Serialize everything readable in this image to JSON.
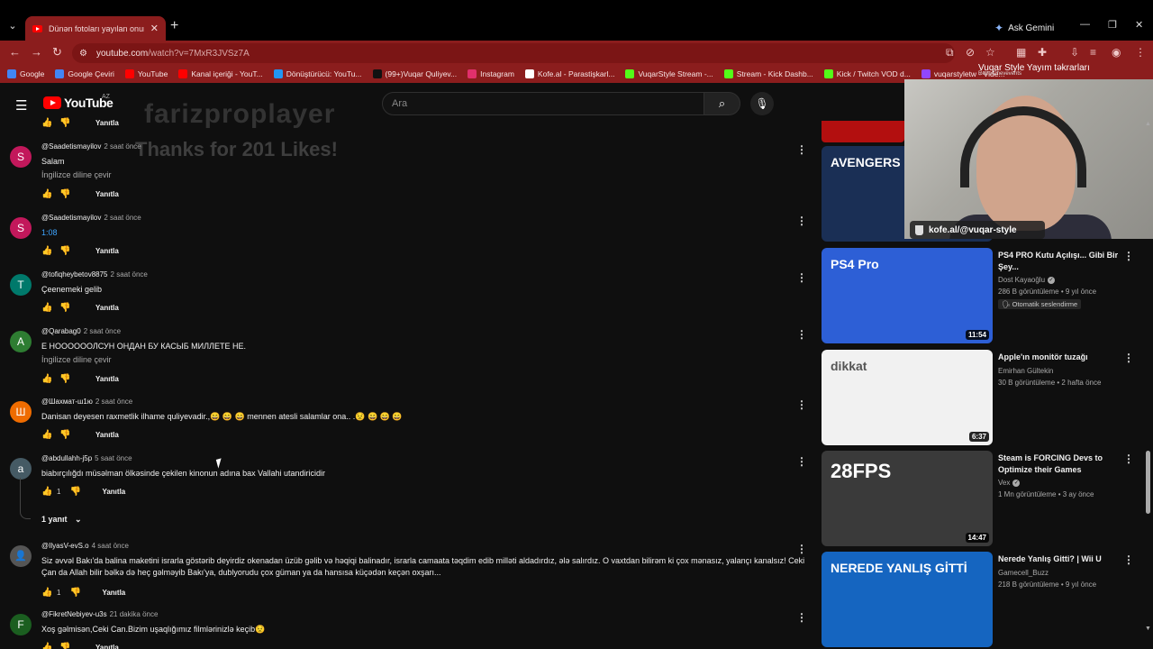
{
  "browser": {
    "tab_title": "Dünən fotoları yayılan onun du",
    "new_tab": "+",
    "ask_gemini": "Ask Gemini",
    "url_host": "youtube.com",
    "url_path": "/watch?v=7MxR3JVSz7A",
    "bookmarks": [
      {
        "label": "Google",
        "color": "#4285f4"
      },
      {
        "label": "Google Çeviri",
        "color": "#4285f4"
      },
      {
        "label": "YouTube",
        "color": "#ff0000"
      },
      {
        "label": "Kanal içeriği - YouT...",
        "color": "#ff0000"
      },
      {
        "label": "Dönüştürücü: YouTu...",
        "color": "#2196f3"
      },
      {
        "label": "(99+)Vuqar Quliyev...",
        "color": "#111111"
      },
      {
        "label": "Instagram",
        "color": "#e1306c"
      },
      {
        "label": "Kofe.al - Parastişkarl...",
        "color": "#ffffff"
      },
      {
        "label": "VuqarStyle Stream -...",
        "color": "#53fc18"
      },
      {
        "label": "Stream - Kick Dashb...",
        "color": "#53fc18"
      },
      {
        "label": "Kick / Twitch VOD d...",
        "color": "#53fc18"
      },
      {
        "label": "vuqarstyletw - Vide...",
        "color": "#9146ff"
      }
    ]
  },
  "youtube": {
    "logo_text": "YouTube",
    "region": "AZ",
    "search_placeholder": "Ara"
  },
  "overlays": {
    "name": "farizproplayer",
    "thanks": "Thanks for 201 Likes!",
    "stream_title": "Vuqar Style Yayım təkrarları",
    "stream_sub": "Retro/Chevevents",
    "kofe": "kofe.al/@vuqar-style"
  },
  "reply_label": "Yanıtla",
  "translate_label": "İngilizce diline çevir",
  "comments": [
    {
      "initial": "S",
      "color": "#c2185b",
      "author": "@Saadetismayilov",
      "time": "2 saat önce",
      "text": "Salam",
      "translate": true,
      "likes": ""
    },
    {
      "initial": "S",
      "color": "#c2185b",
      "author": "@Saadetismayilov",
      "time": "2 saat önce",
      "text": "1:08",
      "translate": false,
      "likes": ""
    },
    {
      "initial": "T",
      "color": "#00796b",
      "author": "@tofiqheybetov8875",
      "time": "2 saat önce",
      "text": "Çeenemeki gelib",
      "translate": false,
      "likes": ""
    },
    {
      "initial": "A",
      "color": "#2e7d32",
      "author": "@Qarabag0",
      "time": "2 saat önce",
      "text": "Е НООООООЛСУН ОНДАН БУ КАСЫБ МИЛЛЕТЕ НЕ.",
      "translate": true,
      "likes": ""
    },
    {
      "initial": "Ш",
      "color": "#ef6c00",
      "author": "@Шахмат-ш1ю",
      "time": "2 saat önce",
      "text": "Danisan deyesen raxmetlik ilhame quliyevadir.,😄 😄 😄  mennen atesli salamlar ona..  .😟 😄 😄 😄",
      "translate": false,
      "likes": ""
    },
    {
      "initial": "a",
      "color": "#455a64",
      "author": "@abdullahh-j5p",
      "time": "5 saat önce",
      "text": "biabırçılığdı müsəlman ölkəsinde çekilen kinonun adına bax Vallahi utandiricidir",
      "translate": false,
      "likes": "1",
      "replies": "1 yanıt"
    },
    {
      "initial": "",
      "color": "#555555",
      "author": "@IlyasV-evS.o",
      "time": "4 saat önce",
      "text": "Siz əvvəl Bakı'da balina maketini israrla göstərib deyirdiz okenadan üzüb gəlib və həqiqi balinadır, israrla camaata təqdim edib milləti aldadırdız, ələ salırdız. O vaxtdan bilirəm ki çox mənasız, yalançı kanalsız! Ceki Çan da Allah bilir bəlkə də heç gəlməyib Bakı'ya, dublyorudu çox güman ya da hansısa küçədən keçən oxşarı...",
      "translate": false,
      "likes": "1"
    },
    {
      "initial": "F",
      "color": "#1b5e20",
      "author": "@FikretNebiyev-u3s",
      "time": "21 dakika önce",
      "text": "Xoş gəlmisən,Ceki Can.Bizim uşaqlığımız filmlərinizlə keçib😟",
      "translate": false,
      "likes": ""
    }
  ],
  "related": [
    {
      "title": "",
      "channel": "",
      "views": "",
      "age": "",
      "duration": "",
      "thumb_bg": "#1a2f55",
      "thumb_text": "AVENGERS"
    },
    {
      "title": "PS4 PRO Kutu Açılışı... Gibi Bir Şey...",
      "channel": "Dost Kayaoğlu",
      "verified": true,
      "views": "286 B görüntüleme",
      "age": "9 yıl önce",
      "badge": "Otomatik seslendirme",
      "duration": "11:54",
      "thumb_bg": "#2d5fd6",
      "thumb_text": "PS4 Pro"
    },
    {
      "title": "Apple'ın monitör tuzağı",
      "channel": "Emirhan Gültekin",
      "views": "30 B görüntüleme",
      "age": "2 hafta önce",
      "duration": "6:37",
      "thumb_bg": "#f1f1f1",
      "thumb_text": "dikkat"
    },
    {
      "title": "Steam is FORCING Devs to Optimize their Games",
      "channel": "Vex",
      "verified": true,
      "views": "1 Mn görüntüleme",
      "age": "3 ay önce",
      "duration": "14:47",
      "thumb_bg": "#3a3a3a",
      "thumb_text": "28FPS"
    },
    {
      "title": "Nerede Yanlış Gitti? | Wii U",
      "channel": "Gamecell_Buzz",
      "views": "218 B görüntüleme",
      "age": "9 yıl önce",
      "duration": "",
      "thumb_bg": "#1565c0",
      "thumb_text": "NEREDE YANLIŞ GİTTİ"
    }
  ]
}
